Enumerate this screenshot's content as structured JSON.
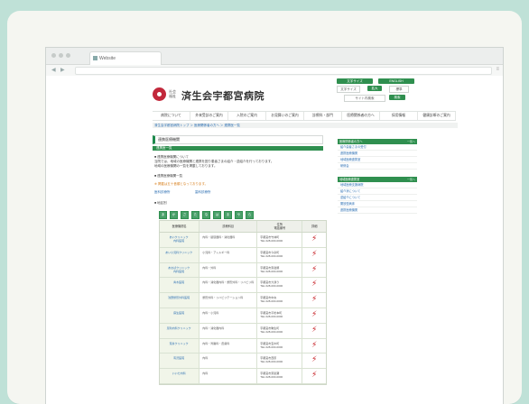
{
  "browser": {
    "tab_title": "Website",
    "back_symbol": "◀",
    "forward_symbol": "▶",
    "menu_symbol": "≡"
  },
  "site": {
    "logo_small": "社会\n福祉",
    "logo_text": "済生会宇都宮病院",
    "header_buttons": [
      {
        "label": "文字サイズ",
        "color": "#2f8f4f"
      },
      {
        "label": "ENGLISH",
        "color": "#2f8f4f"
      },
      {
        "label": "拡大",
        "color": "#2f8f4f"
      },
      {
        "label": "標準",
        "color": "#2f8f4f"
      },
      {
        "label": "検索",
        "color": "#2f8f4f"
      }
    ],
    "header_boxes": [
      "文字サイズ",
      "サイト内検索"
    ],
    "gnav": [
      "病院について",
      "外来受診のご案内",
      "入院のご案内",
      "お見舞いのご案内",
      "診療科・部門",
      "医療関係者の方へ",
      "採用情報",
      "健康診断のご案内"
    ],
    "breadcrumb": "済生会宇都宮病院トップ ＞ 医療関係者の方へ ＞ 連携医一覧",
    "page_title": "連携医療機関",
    "green_bar": "連携医一覧",
    "notes": [
      "■ 連携医療機関について",
      "当院では、地域の医療機関と連携を図り患者さまの紹介・逆紹介を行っております。",
      "地域の医療機関の一覧を掲載しております。"
    ],
    "section_label": "■ 連携医療機関一覧",
    "orange_note": "※ 掲載は五十音順となっております。",
    "filter_links": [
      "医科診療所",
      "歯科診療所"
    ],
    "area_label": "■ 地区別",
    "pager": [
      "あ",
      "か",
      "さ",
      "た",
      "な",
      "は",
      "ま",
      "や",
      "ら"
    ],
    "table": {
      "headers": [
        "医療機関名",
        "診療科目",
        "住所\n電話番号",
        "詳細"
      ],
      "rows": [
        {
          "name": "あいクリニック\n内科医院",
          "dept": "内科・循環器科・消化器科",
          "addr": "宇都宮市竹林町\nTEL 028-000-0000"
        },
        {
          "name": "あい小児科クリニック",
          "dept": "小児科・アレルギー科",
          "addr": "宇都宮市今泉町\nTEL 028-000-0000"
        },
        {
          "name": "あおばクリニック\n内科医院",
          "dept": "内科・外科",
          "addr": "宇都宮市東宿郷\nTEL 028-000-0000"
        },
        {
          "name": "青木医院",
          "dept": "内科・消化器内科・整形外科・リハビリ科",
          "addr": "宇都宮市大通り\nTEL 028-000-0000"
        },
        {
          "name": "浅野整形外科医院",
          "dept": "整形外科・リハビリテーション科",
          "addr": "宇都宮市中央\nTEL 028-000-0000"
        },
        {
          "name": "麻生医院",
          "dept": "内科・小児科",
          "addr": "宇都宮市平松本町\nTEL 028-000-0000"
        },
        {
          "name": "足利内科クリニック",
          "dept": "内科・消化器内科",
          "addr": "宇都宮市駒生町\nTEL 028-000-0000"
        },
        {
          "name": "荒井クリニック",
          "dept": "内科・胃腸科・皮膚科",
          "addr": "宇都宮市宝木町\nTEL 028-000-0000"
        },
        {
          "name": "有沢医院",
          "dept": "内科",
          "addr": "宇都宮市西原\nTEL 028-000-0000"
        },
        {
          "name": "いいだ内科",
          "dept": "内科",
          "addr": "宇都宮市東簗瀬\nTEL 028-000-0000"
        }
      ]
    },
    "sidebar": [
      {
        "title": "医療関係者の方へ",
        "more": "一覧へ",
        "items": [
          "紹介患者さまの受付",
          "連携医療機関",
          "地域医療連携室",
          "研修会"
        ]
      },
      {
        "title": "地域医療連携室",
        "more": "一覧へ",
        "items": [
          "地域医療支援病院",
          "紹介状について",
          "逆紹介について",
          "開放型病床",
          "連携医療機関"
        ]
      }
    ]
  }
}
